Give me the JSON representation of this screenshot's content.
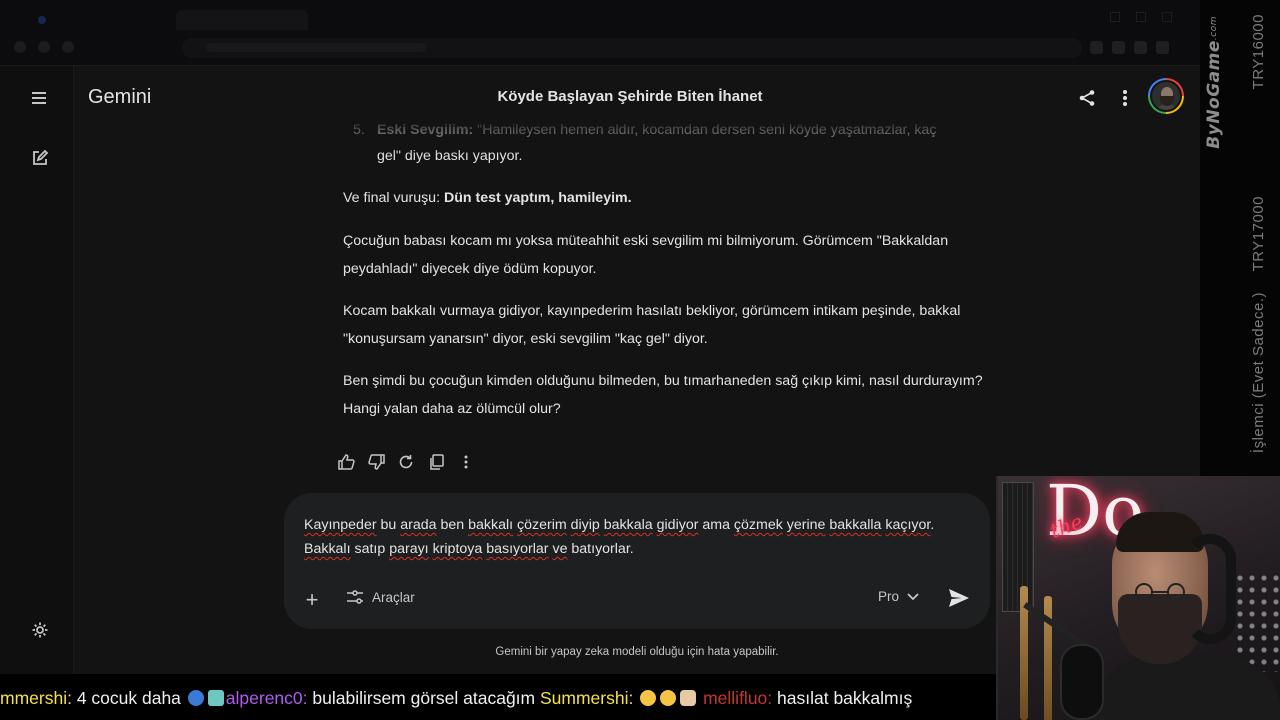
{
  "app": {
    "brand": "Gemini",
    "chat_title": "Köyde Başlayan Şehirde Biten İhanet"
  },
  "conversation": {
    "list_item_number": "5.",
    "list_item_bold": "Eski Sevgilim:",
    "list_item_text": "\"Hamileysen hemen aldır, kocamdan dersen seni köyde yaşatmazlar, kaç",
    "list_item_continuation": "gel\" diye baskı yapıyor.",
    "final_prefix": "Ve final vuruşu: ",
    "final_bold": "Dün test yaptım, hamileyim.",
    "paragraphs": [
      "Çocuğun babası kocam mı yoksa müteahhit eski sevgilim mi bilmiyorum. Görümcem \"Bakkaldan peydahladı\" diyecek diye ödüm kopuyor.",
      "Kocam bakkalı vurmaya gidiyor, kayınpederim hasılatı bekliyor, görümcem intikam peşinde, bakkal \"konuşursam yanarsın\" diyor, eski sevgilim \"kaç gel\" diyor.",
      "Ben şimdi bu çocuğun kimden olduğunu bilmeden, bu tımarhaneden sağ çıkıp kimi, nasıl durdurayım? Hangi yalan daha az ölümcül olur?"
    ]
  },
  "composer": {
    "w": [
      "Kayınpeder",
      " bu ",
      "arada",
      " ben ",
      "bakkalı",
      " ",
      "çözerim",
      " ",
      "diyip",
      " ",
      "bakkala",
      " ",
      "gidiyor",
      " ama ",
      "çözmek",
      " ",
      "yerine",
      " ",
      "bakkalla",
      " ",
      "kaçıyor",
      ". ",
      "Bakkalı",
      " satıp ",
      "parayı",
      " ",
      "kriptoya",
      " ",
      "basıyorlar",
      " ",
      "ve",
      " ",
      "batıyorlar",
      "."
    ],
    "tools_label": "Araçlar",
    "model_label": "Pro"
  },
  "disclaimer": "Gemini bir yapay zeka modeli olduğu için hata yapabilir.",
  "overlay": {
    "brand_text": "ByNoGame",
    "brand_suffix": ".com",
    "vtext_1": "TRY16000",
    "vtext_2": "TRY17000",
    "vtext_3": "İşlemci (Evet Sadece.)"
  },
  "chat_ticker": {
    "user1": "mmershi:",
    "msg1": " 4 cocuk daha ",
    "user2": "alperenc0:",
    "msg2": " bulabilirsem görsel atacağım ",
    "user3": "Summershi:",
    "user4": "mellifluo:",
    "msg4": " hasılat bakkalmış"
  },
  "colors": {
    "accent_red": "#d93025",
    "app_bg": "#131314",
    "composer_bg": "#1e1f20",
    "ticker_yellow": "#f7e04a",
    "ticker_purple": "#b05cf0"
  },
  "icons": [
    "menu-icon",
    "new-chat-icon",
    "settings-icon",
    "share-icon",
    "more-vert-icon",
    "thumbs-up-icon",
    "thumbs-down-icon",
    "regenerate-icon",
    "copy-icon",
    "plus-icon",
    "tools-icon",
    "chevron-down-icon",
    "send-icon"
  ]
}
